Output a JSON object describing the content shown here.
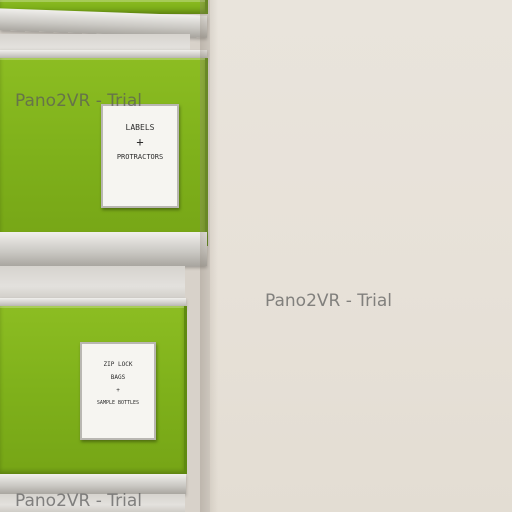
{
  "watermark": {
    "text_top": "Pano2VR - Trial",
    "text_center": "Pano2VR - Trial",
    "text_bottom": "Pano2VR - Trial"
  },
  "drawers": [
    {
      "label_lines": [
        "LABELS",
        "+",
        "PROTRACTORS"
      ]
    },
    {
      "label_lines": [
        "ZIP LOCK",
        "BAGS",
        "+",
        "SAMPLE BOTTLES"
      ]
    }
  ],
  "colors": {
    "drawer_green": "#7fb11b",
    "wall": "#e9e4dc",
    "rail_silver": "#c9c7c2"
  }
}
